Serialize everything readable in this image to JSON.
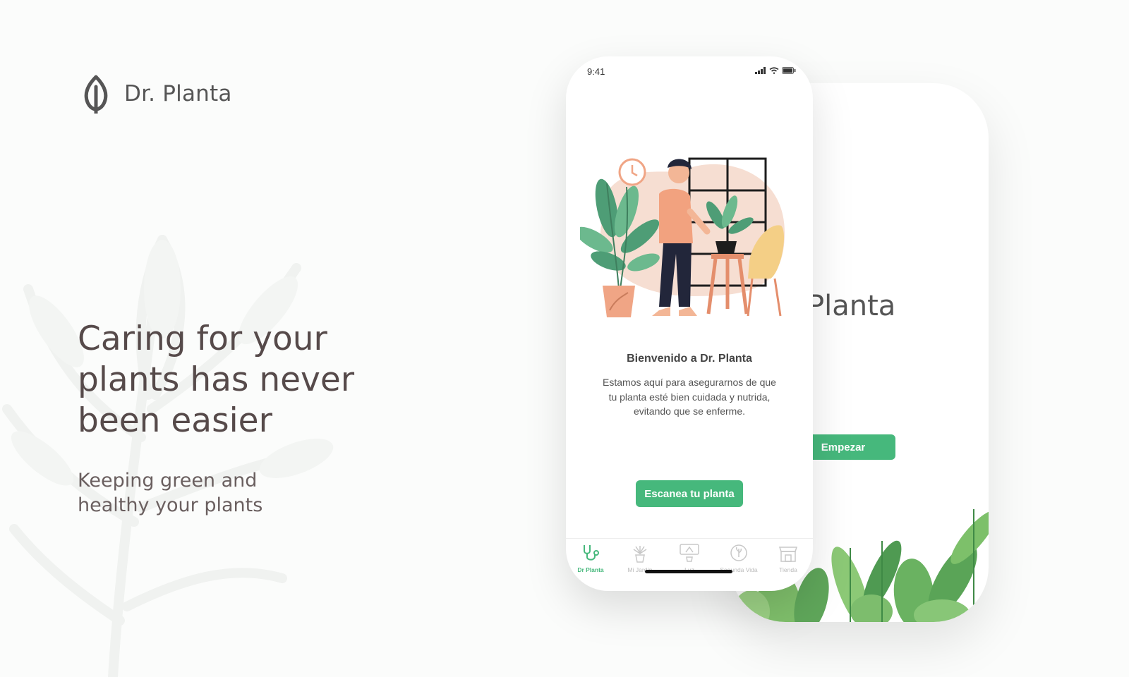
{
  "brand": {
    "name": "Dr. Planta",
    "logo_icon": "leaf-icon"
  },
  "hero": {
    "headline": "Caring for your plants has never been easier",
    "subline": "Keeping green and healthy your plants"
  },
  "colors": {
    "accent": "#46b87c",
    "text_dark": "#564a4a",
    "background": "#fbfcfb"
  },
  "back_screen": {
    "title": "Dr. Planta",
    "cta_label": "Empezar"
  },
  "front_screen": {
    "status_time": "9:41",
    "status_icons": [
      "signal-icon",
      "wifi-icon",
      "battery-icon"
    ],
    "welcome_title": "Bienvenido a Dr. Planta",
    "welcome_body": "Estamos aquí para asegurarnos de que tu planta esté bien cuidada y nutrida, evitando que se enferme.",
    "cta_label": "Escanea tu planta",
    "tabs": [
      {
        "label": "Dr Planta",
        "icon": "stethoscope-icon",
        "active": true
      },
      {
        "label": "Mi Jardín",
        "icon": "potted-plant-icon",
        "active": false
      },
      {
        "label": "Luz",
        "icon": "lamp-icon",
        "active": false
      },
      {
        "label": "Segunda Vida",
        "icon": "recycle-icon",
        "active": false
      },
      {
        "label": "Tienda",
        "icon": "store-icon",
        "active": false
      }
    ]
  }
}
